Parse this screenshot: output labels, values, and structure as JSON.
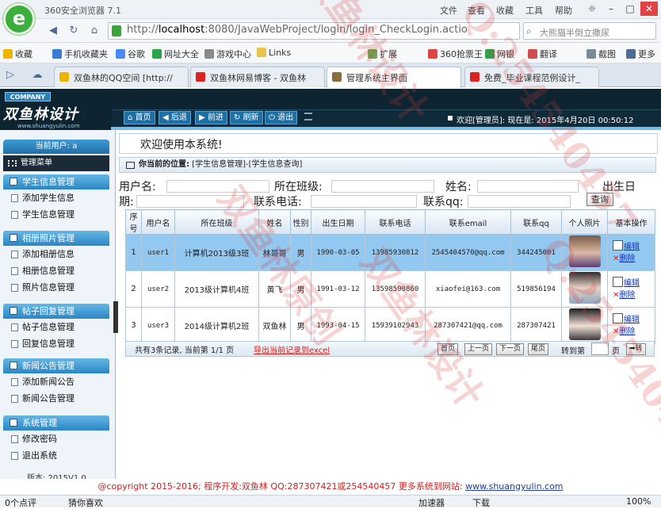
{
  "browser": {
    "app_title": "360安全浏览器 7.1",
    "menu": [
      "文件",
      "查看",
      "收藏",
      "工具",
      "帮助"
    ],
    "url_host": "localhost",
    "url_rest": ":8080/JavaWebProject/login/login_CheckLogin.actio",
    "search_placeholder": "大熊猫半倒立撒尿",
    "bookmarks": [
      "收藏",
      "手机收藏夹",
      "谷歌",
      "网址大全",
      "游戏中心",
      "Links",
      "扩展",
      "360抢票王",
      "网银",
      "翻译",
      "截图",
      "更多"
    ],
    "tabs": [
      {
        "title": "双鱼林的QQ空间 [http://",
        "active": false
      },
      {
        "title": "双鱼林网易博客 - 双鱼林",
        "active": false
      },
      {
        "title": "管理系统主界面",
        "active": true
      },
      {
        "title": "免费_毕业课程范例设计_",
        "active": false
      }
    ]
  },
  "header": {
    "company_tag": "COMPANY",
    "logo_text": "双鱼林设计",
    "logo_url": "www.shuangyulin.com",
    "nav": [
      "首页",
      "后退",
      "前进",
      "刷新",
      "退出"
    ],
    "welcome": "欢迎[管理员]:   现在是: 2015年4月20日  00:50:12"
  },
  "sidebar": {
    "current_user": "当前用户: a",
    "manager_menu": "管理菜单",
    "groups": [
      {
        "title": "学生信息管理",
        "items": [
          "添加学生信息",
          "学生信息管理"
        ]
      },
      {
        "title": "相册照片管理",
        "items": [
          "添加相册信息",
          "相册信息管理",
          "照片信息管理"
        ]
      },
      {
        "title": "帖子回复管理",
        "items": [
          "帖子信息管理",
          "回复信息管理"
        ]
      },
      {
        "title": "新闻公告管理",
        "items": [
          "添加新闻公告",
          "新闻公告管理"
        ]
      },
      {
        "title": "系统管理",
        "items": [
          "修改密码",
          "退出系统"
        ]
      }
    ],
    "version": "版本: 2015V1.0"
  },
  "main": {
    "welcome_text": "欢迎使用本系统!",
    "location_label": "你当前的位置:",
    "location_path": "[学生信息管理]-[学生信息查询]",
    "search": {
      "username_label": "用户名:",
      "class_label": "所在班级:",
      "name_label": "姓名:",
      "birth_label_a": "出生日",
      "birth_label_b": "期:",
      "phone_label": "联系电话:",
      "qq_label": "联系qq:",
      "query_button": "查询"
    },
    "table": {
      "headers": [
        "序号",
        "用户名",
        "所在班级",
        "姓名",
        "性别",
        "出生日期",
        "联系电话",
        "联系email",
        "联系qq",
        "个人照片",
        "基本操作"
      ],
      "rows": [
        [
          "1",
          "user1",
          "计算机2013级3班",
          "林哥哥",
          "男",
          "1990-03-05",
          "13985930812",
          "2545404570@qq.com",
          "344245001"
        ],
        [
          "2",
          "user2",
          "2013级计算机4班",
          "黄飞",
          "男",
          "1991-03-12",
          "13598590860",
          "xiaofei@163.com",
          "519856194"
        ],
        [
          "3",
          "user3",
          "2014级计算机2班",
          "双鱼林",
          "男",
          "1993-04-15",
          "15939102943",
          "287307421@qq.com",
          "287307421"
        ]
      ],
      "edit_label": "编辑",
      "delete_label": "删除"
    },
    "pager": {
      "summary": "共有3条记录, 当前第 1/1 页",
      "export": "导出当前记录到excel",
      "first": "首页",
      "prev": "上一页",
      "next": "下一页",
      "last": "尾页",
      "goto_label": "转到第",
      "page_unit": "页",
      "go": "转"
    }
  },
  "footer": {
    "copyright": "@copyright 2015-2016; 程序开发:双鱼林  QQ:287307421或254540457  更多系统到网站: ",
    "site": "www.shuangyulin.com"
  },
  "statusbar": {
    "left": [
      "0个点评",
      "猜你喜欢"
    ],
    "right": [
      "加速器",
      "下载",
      "100%"
    ]
  },
  "watermark": [
    "双鱼林设计",
    "Q:254540457",
    "双鱼林原创"
  ],
  "colors": {
    "header_bg": "#0e2430",
    "menu_group": "#2b86c4",
    "selected_row": "#93c8f0",
    "footer_red": "#cc2222"
  }
}
